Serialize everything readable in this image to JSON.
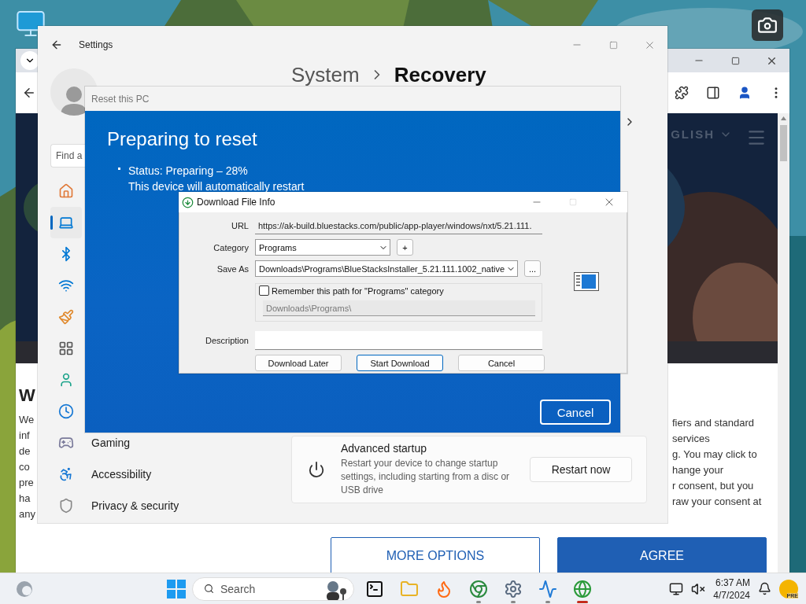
{
  "browser": {
    "header_text": "GLISH",
    "left_heading": "W",
    "left_fragments": [
      "We",
      "inf",
      "de",
      "co",
      "pre",
      "ha",
      "any"
    ],
    "right_fragments": [
      "fiers and standard",
      "services",
      "g. You may click to",
      "hange your",
      "r consent, but you",
      "raw your consent at"
    ],
    "buttons": [
      {
        "label": "MORE OPTIONS",
        "kind": "outline"
      },
      {
        "label": "AGREE",
        "kind": "filled"
      }
    ]
  },
  "settings": {
    "title": "Settings",
    "search": {
      "placeholder": "Find a"
    },
    "breadcrumb": [
      "System",
      "Recovery"
    ],
    "nav": [
      {
        "selected": false
      },
      {
        "selected": true
      },
      {
        "selected": false
      },
      {
        "selected": false
      },
      {
        "selected": false
      },
      {
        "selected": false
      },
      {
        "selected": false
      },
      {
        "selected": false
      },
      {
        "label": "Gaming",
        "selected": false
      },
      {
        "label": "Accessibility",
        "selected": false
      },
      {
        "label": "Privacy & security",
        "selected": false
      }
    ],
    "advanced_startup": {
      "title": "Advanced startup",
      "description": "Restart your device to change startup settings, including starting from a disc or USB drive",
      "button": "Restart now"
    }
  },
  "reset_dialog": {
    "title": "Reset this PC",
    "heading": "Preparing to reset",
    "status": "Status: Preparing – 28%",
    "note": "This device will automatically restart",
    "button": "Cancel"
  },
  "download_dialog": {
    "title": "Download File Info",
    "url_label": "URL",
    "url": "https://ak-build.bluestacks.com/public/app-player/windows/nxt/5.21.111.",
    "category_label": "Category",
    "category": "Programs",
    "add_button": "+",
    "save_as_label": "Save As",
    "save_as": "Downloads\\Programs\\BlueStacksInstaller_5.21.111.1002_native",
    "browse_button": "...",
    "remember": {
      "label": "Remember this path for \"Programs\" category",
      "checked": false
    },
    "path": "Downloads\\Programs\\",
    "description_label": "Description",
    "buttons": [
      {
        "label": "Download Later",
        "selected": false
      },
      {
        "label": "Start Download",
        "selected": true
      },
      {
        "label": "Cancel",
        "selected": false
      }
    ]
  },
  "taskbar": {
    "search_placeholder": "Search",
    "apps": [
      {
        "running": false,
        "selected": false
      },
      {
        "running": false,
        "selected": false
      },
      {
        "running": false,
        "selected": false
      },
      {
        "running": true,
        "selected": false
      },
      {
        "running": true,
        "selected": false
      },
      {
        "running": true,
        "selected": false
      },
      {
        "running": true,
        "selected": true
      }
    ],
    "time": "6:37 AM",
    "date": "4/7/2024",
    "badge": "PRE"
  }
}
